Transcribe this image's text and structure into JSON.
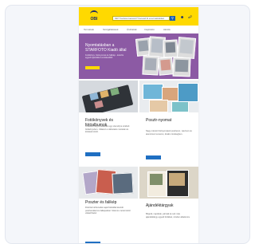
{
  "header": {
    "logo": "OBI",
    "search_placeholder": "Mit? Kedves keresni? Keresd itt a termékünket"
  },
  "nav": {
    "items": [
      "Termékek",
      "Szolgáltatások",
      "Áruházak",
      "Inspiráció",
      "Akciók"
    ]
  },
  "hero": {
    "title": "Nyomtatásban a STARFOTO Kiadó által",
    "text": "Fotókönyv, fotónyomat és falikép - készíts egyedi ajándékot emlékeidből",
    "button": ""
  },
  "tiles": [
    {
      "title": "Fotókönyvek és fotóalbumok",
      "text": "Örökítsd meg emlékeidet egy személyre szabott fotókönyvben. Válassz a változatos méretek és kötések közül.",
      "button": ""
    },
    {
      "title": "Posztr-nyomat",
      "text": "Nagy méretű fotónyomatok poszteren, vásznon és alumínium lemezen, kiváló minőségben.",
      "button": ""
    },
    {
      "title": "Poszter és falikép",
      "text": "Díszítsd otthonodat saját fotóiddal készült poszterekkel és falképekkel. Számos méret közül választhatsz.",
      "button": ""
    },
    {
      "title": "Ajándéktárgyak",
      "text": "Bögrék, naptárak, párnák és sok más ajándéktárgy egyedi fotókkal, minden alkalomra.",
      "button": ""
    }
  ],
  "colors": {
    "header": "#ffd900",
    "brand": "#1a2b6b",
    "hero": "#8c5aa4",
    "button": "#1f6fc2"
  }
}
